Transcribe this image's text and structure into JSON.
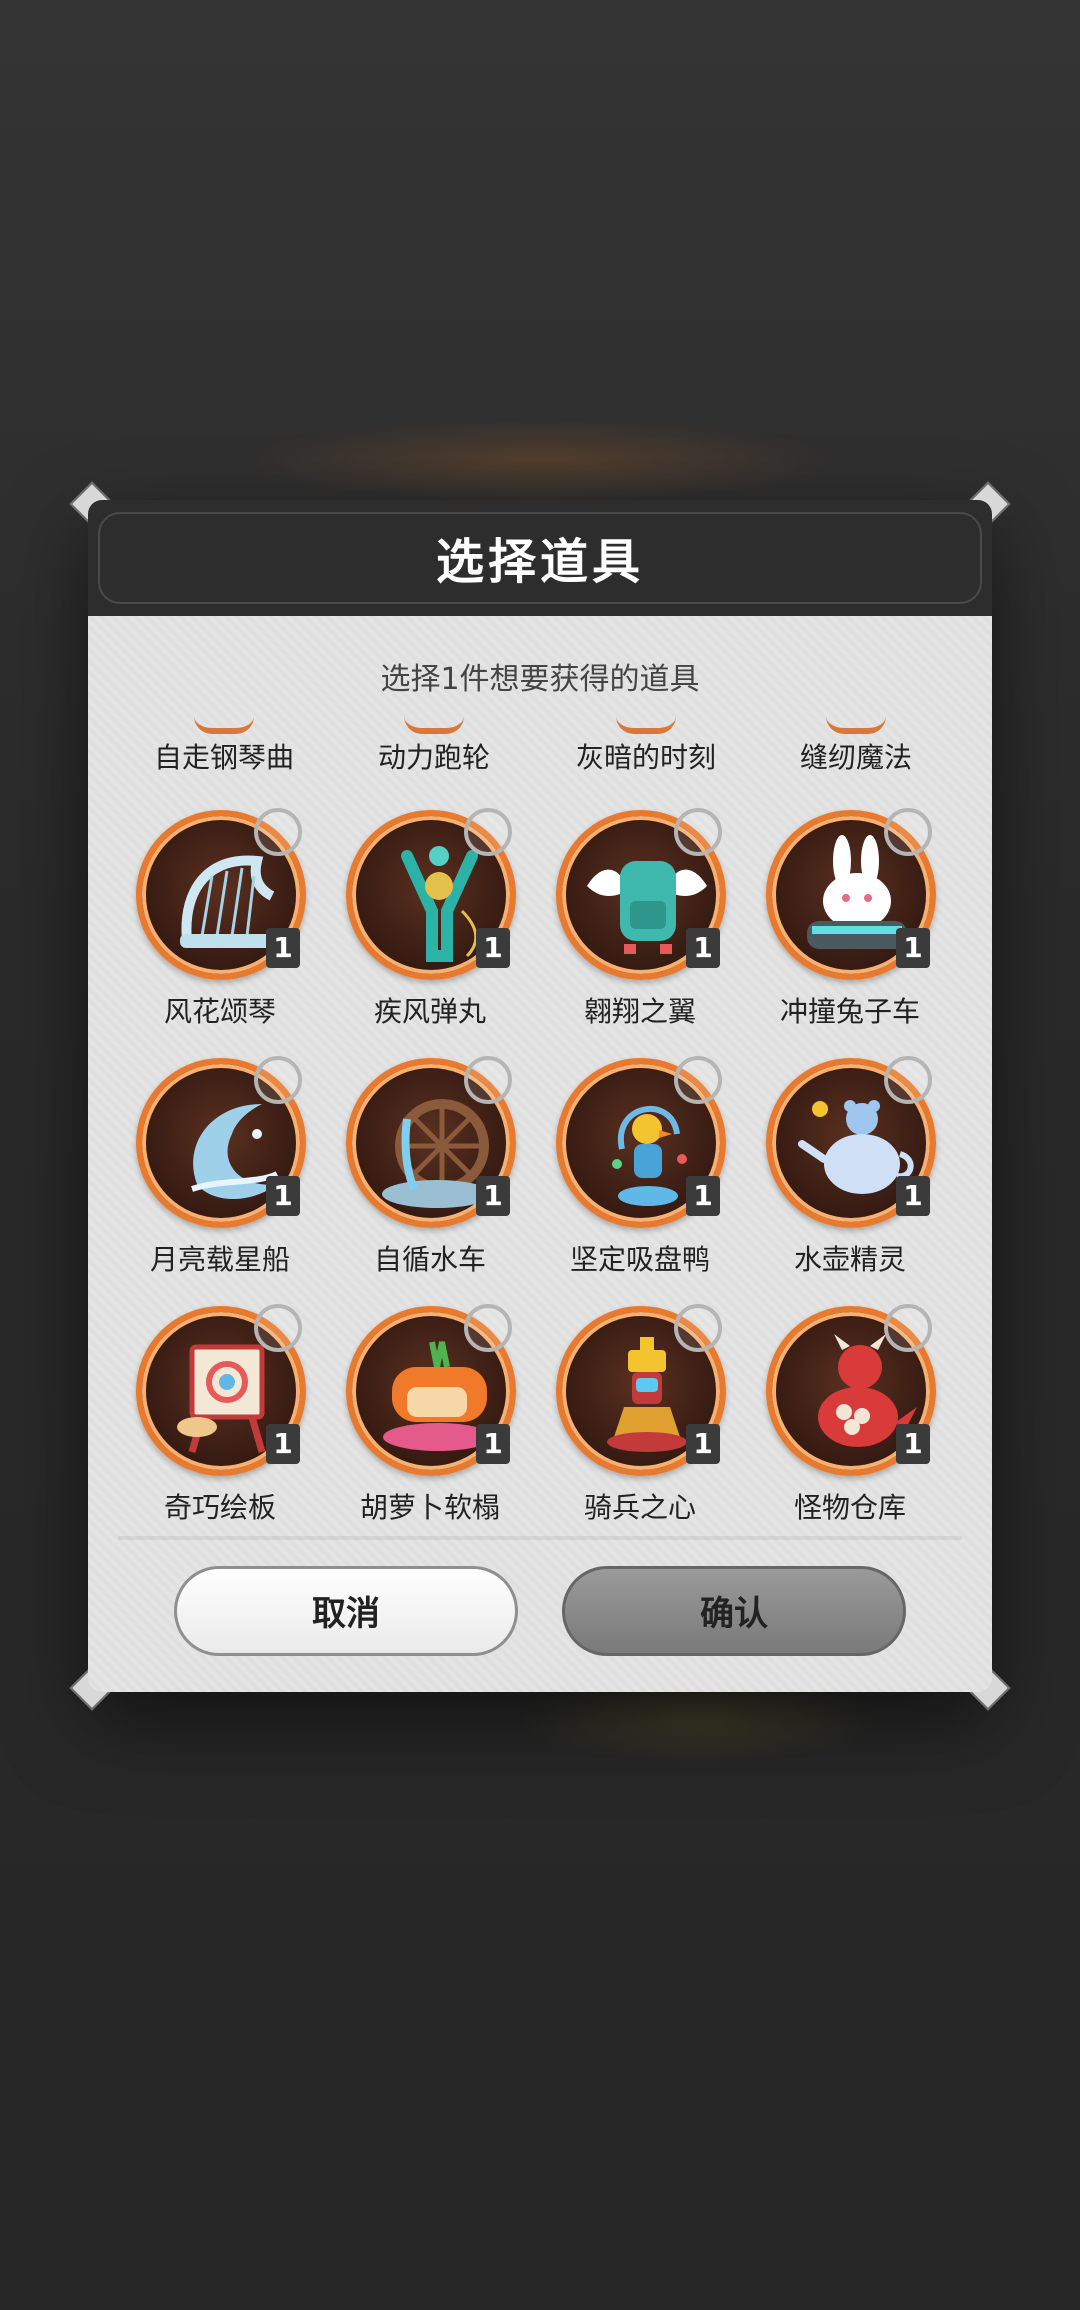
{
  "dialog": {
    "title": "选择道具",
    "subtitle": "选择1件想要获得的道具",
    "cancel_label": "取消",
    "confirm_label": "确认"
  },
  "partial_items": [
    {
      "label": "自走钢琴曲"
    },
    {
      "label": "动力跑轮"
    },
    {
      "label": "灰暗的时刻"
    },
    {
      "label": "缝纫魔法"
    }
  ],
  "items": [
    {
      "label": "风花颂琴",
      "qty": "1",
      "icon": "harp-icon"
    },
    {
      "label": "疾风弹丸",
      "qty": "1",
      "icon": "slingshot-icon"
    },
    {
      "label": "翱翔之翼",
      "qty": "1",
      "icon": "winged-backpack-icon"
    },
    {
      "label": "冲撞兔子车",
      "qty": "1",
      "icon": "bunny-car-icon"
    },
    {
      "label": "月亮载星船",
      "qty": "1",
      "icon": "moon-wave-icon"
    },
    {
      "label": "自循水车",
      "qty": "1",
      "icon": "waterwheel-icon"
    },
    {
      "label": "坚定吸盘鸭",
      "qty": "1",
      "icon": "duck-toy-icon"
    },
    {
      "label": "水壶精灵",
      "qty": "1",
      "icon": "teapot-bear-icon"
    },
    {
      "label": "奇巧绘板",
      "qty": "1",
      "icon": "easel-icon"
    },
    {
      "label": "胡萝卜软榻",
      "qty": "1",
      "icon": "carrot-sofa-icon"
    },
    {
      "label": "骑兵之心",
      "qty": "1",
      "icon": "chess-knight-icon"
    },
    {
      "label": "怪物仓库",
      "qty": "1",
      "icon": "dragon-icon"
    }
  ],
  "colors": {
    "ring": "#e77a2e",
    "header": "#2d2d2d",
    "panel": "#e4e4e4"
  }
}
